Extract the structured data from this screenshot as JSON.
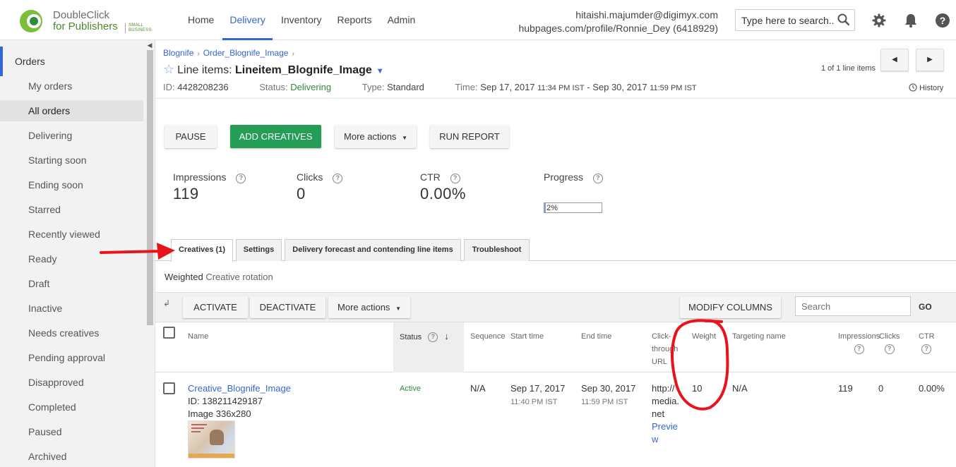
{
  "app": {
    "logo_line1": "DoubleClick",
    "logo_line2": "for Publishers",
    "logo_badge_1": "SMALL",
    "logo_badge_2": "BUSINESS"
  },
  "nav": {
    "items": [
      {
        "label": "Home",
        "active": false
      },
      {
        "label": "Delivery",
        "active": true
      },
      {
        "label": "Inventory",
        "active": false
      },
      {
        "label": "Reports",
        "active": false
      },
      {
        "label": "Admin",
        "active": false
      }
    ]
  },
  "user": {
    "email": "hitaishi.majumder@digimyx.com",
    "network": "hubpages.com/profile/Ronnie_Dey (6418929)"
  },
  "search": {
    "placeholder": "Type here to search..."
  },
  "header_icons": [
    "search-icon",
    "gear-icon",
    "bell-icon",
    "help-icon"
  ],
  "sidebar": {
    "section": "Orders",
    "items": [
      {
        "label": "My orders",
        "selected": false
      },
      {
        "label": "All orders",
        "selected": true
      },
      {
        "label": "Delivering",
        "selected": false
      },
      {
        "label": "Starting soon",
        "selected": false
      },
      {
        "label": "Ending soon",
        "selected": false
      },
      {
        "label": "Starred",
        "selected": false
      },
      {
        "label": "Recently viewed",
        "selected": false
      },
      {
        "label": "Ready",
        "selected": false
      },
      {
        "label": "Draft",
        "selected": false
      },
      {
        "label": "Inactive",
        "selected": false
      },
      {
        "label": "Needs creatives",
        "selected": false
      },
      {
        "label": "Pending approval",
        "selected": false
      },
      {
        "label": "Disapproved",
        "selected": false
      },
      {
        "label": "Completed",
        "selected": false
      },
      {
        "label": "Paused",
        "selected": false
      },
      {
        "label": "Archived",
        "selected": false
      }
    ]
  },
  "breadcrumb": [
    "Blognife",
    "Order_Blognife_Image"
  ],
  "lineitem": {
    "prefix": "Line items:",
    "name": "Lineitem_Blognife_Image",
    "id_label": "ID:",
    "id": "4428208236",
    "status_label": "Status:",
    "status": "Delivering",
    "type_label": "Type:",
    "type": "Standard",
    "time_label": "Time:",
    "start_date": "Sep 17, 2017",
    "start_time": "11:34 PM IST",
    "end_date": "Sep 30, 2017",
    "end_time": "11:59 PM IST",
    "pager": "1 of 1 line items",
    "history": "History"
  },
  "actions": {
    "pause": "PAUSE",
    "add_creatives": "ADD CREATIVES",
    "more_actions": "More actions",
    "run_report": "RUN REPORT"
  },
  "stats": {
    "impressions_label": "Impressions",
    "impressions": "119",
    "clicks_label": "Clicks",
    "clicks": "0",
    "ctr_label": "CTR",
    "ctr": "0.00%",
    "progress_label": "Progress",
    "progress_text": "2%",
    "progress_fraction": 0.02
  },
  "tabs": [
    {
      "label": "Creatives (1)",
      "active": true
    },
    {
      "label": "Settings",
      "active": false
    },
    {
      "label": "Delivery forecast and contending line items",
      "active": false
    },
    {
      "label": "Troubleshoot",
      "active": false
    }
  ],
  "rotation": {
    "bold": "Weighted",
    "rest": "Creative rotation"
  },
  "table_toolbar": {
    "activate": "ACTIVATE",
    "deactivate": "DEACTIVATE",
    "more_actions": "More actions",
    "modify_columns": "MODIFY COLUMNS",
    "search_placeholder": "Search",
    "go": "GO"
  },
  "columns": {
    "name": "Name",
    "status": "Status",
    "sequence": "Sequence",
    "start_time": "Start time",
    "end_time": "End time",
    "click_1": "Click-",
    "click_2": "through",
    "click_3": "URL",
    "weight": "Weight",
    "targeting": "Targeting name",
    "impressions": "Impressions",
    "clicks": "Clicks",
    "ctr": "CTR"
  },
  "row": {
    "name": "Creative_Blognife_Image",
    "id": "ID: 138211429187",
    "size": "Image 336x280",
    "status": "Active",
    "sequence": "N/A",
    "start_date": "Sep 17, 2017",
    "start_time": "11:40 PM IST",
    "end_date": "Sep 30, 2017",
    "end_time": "11:59 PM IST",
    "url_1": "http://",
    "url_2": "media.",
    "url_3": "net",
    "preview_1": "Previe",
    "preview_2": "w",
    "weight": "10",
    "targeting": "N/A",
    "impressions": "119",
    "clicks": "0",
    "ctr": "0.00%"
  },
  "colors": {
    "accent_blue": "#3367d6",
    "green_button": "#249e57",
    "status_green": "#2f8a3c",
    "annotation_red": "#e8141b"
  }
}
